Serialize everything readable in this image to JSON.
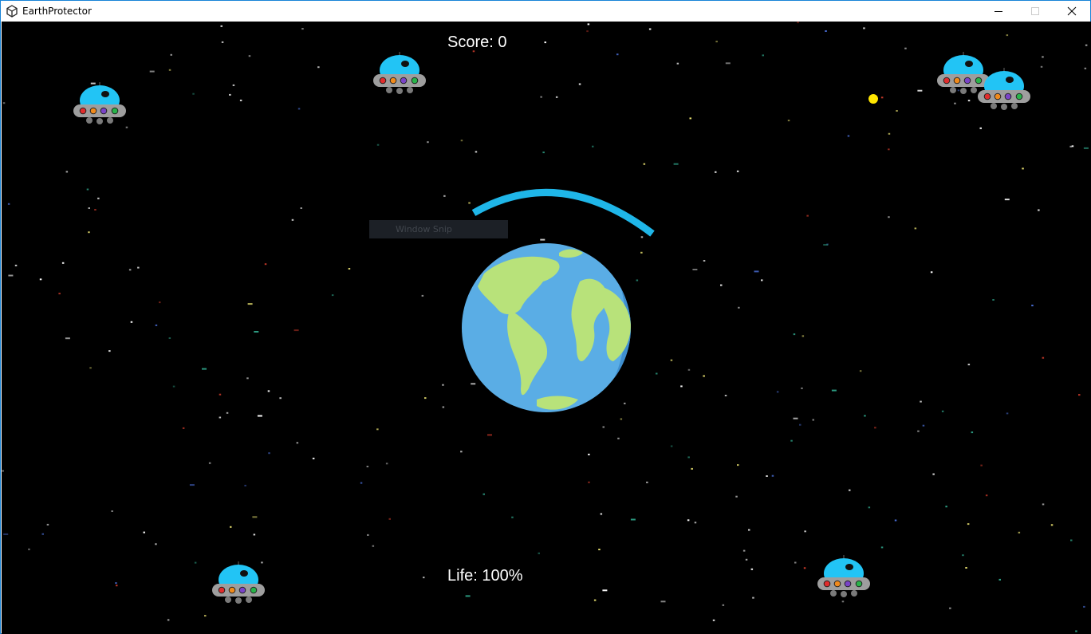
{
  "window": {
    "title": "EarthProtector",
    "border_color": "#1883d7"
  },
  "titlebar_controls": {
    "minimize_icon": "minimize-icon",
    "maximize_icon": "maximize-icon",
    "close_icon": "close-icon"
  },
  "hud": {
    "score_text": "Score: 0",
    "life_text": "Life: 100%"
  },
  "overlay": {
    "label": "Window Snip"
  },
  "game": {
    "background_color": "#000000",
    "shield_color": "#1fb6e8",
    "ocean_color": "#5aade5",
    "land_color": "#b8e27a",
    "bullet_color": "#ffe600",
    "ufo_count": 6
  }
}
